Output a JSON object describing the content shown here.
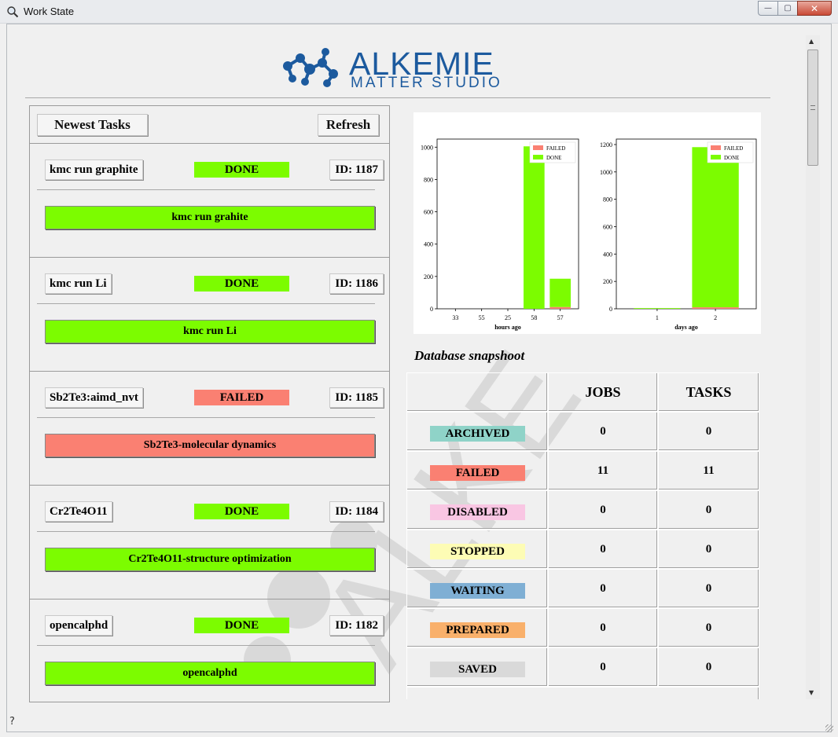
{
  "window": {
    "title": "Work State",
    "controls": {
      "minimize": "—",
      "maximize": "▢",
      "close": "✕"
    }
  },
  "logo": {
    "line1": "ALKEMIE",
    "line2": "MATTER STUDIO",
    "color": "#1c5a9e"
  },
  "task_panel": {
    "header_label": "Newest Tasks",
    "refresh_label": "Refresh",
    "tasks": [
      {
        "name": "kmc run graphite",
        "status": "DONE",
        "id": "ID: 1187",
        "description": "kmc run grahite"
      },
      {
        "name": "kmc run Li",
        "status": "DONE",
        "id": "ID: 1186",
        "description": "kmc run Li"
      },
      {
        "name": "Sb2Te3:aimd_nvt",
        "status": "FAILED",
        "id": "ID: 1185",
        "description": "Sb2Te3-molecular dynamics"
      },
      {
        "name": "Cr2Te4O11",
        "status": "DONE",
        "id": "ID: 1184",
        "description": "Cr2Te4O11-structure optimization"
      },
      {
        "name": "opencalphd",
        "status": "DONE",
        "id": "ID: 1182",
        "description": "opencalphd"
      }
    ]
  },
  "status_colors": {
    "DONE": "#7cfc00",
    "FAILED": "#fa8072",
    "ARCHIVED": "#8fd3c8",
    "DISABLED": "#f9c6e3",
    "STOPPED": "#fdfcb5",
    "WAITING": "#7fafd4",
    "PREPARED": "#f9b06b",
    "SAVED": "#d9d9d9"
  },
  "chart_data": [
    {
      "type": "bar",
      "stacked": true,
      "categories": [
        "33",
        "55",
        "25",
        "58",
        "57"
      ],
      "xlabel": "hours ago",
      "ylabel": "",
      "ylim": [
        0,
        1050
      ],
      "yticks": [
        0,
        200,
        400,
        600,
        800,
        1000
      ],
      "legend_position": "top-right",
      "series": [
        {
          "name": "FAILED",
          "color": "#fa8072",
          "values": [
            0,
            0,
            0,
            0,
            11
          ]
        },
        {
          "name": "DONE",
          "color": "#7cfc00",
          "values": [
            0,
            0,
            0,
            1005,
            175
          ]
        }
      ]
    },
    {
      "type": "bar",
      "stacked": true,
      "categories": [
        "1",
        "2"
      ],
      "xlabel": "days ago",
      "ylabel": "",
      "ylim": [
        0,
        1240
      ],
      "yticks": [
        0,
        200,
        400,
        600,
        800,
        1000,
        1200
      ],
      "legend_position": "top-right",
      "series": [
        {
          "name": "FAILED",
          "color": "#fa8072",
          "values": [
            0,
            11
          ]
        },
        {
          "name": "DONE",
          "color": "#7cfc00",
          "values": [
            5,
            1170
          ]
        }
      ]
    }
  ],
  "database": {
    "title": "Database snapshoot",
    "columns": [
      "",
      "JOBS",
      "TASKS"
    ],
    "rows": [
      {
        "state": "ARCHIVED",
        "jobs": "0",
        "tasks": "0"
      },
      {
        "state": "FAILED",
        "jobs": "11",
        "tasks": "11"
      },
      {
        "state": "DISABLED",
        "jobs": "0",
        "tasks": "0"
      },
      {
        "state": "STOPPED",
        "jobs": "0",
        "tasks": "0"
      },
      {
        "state": "WAITING",
        "jobs": "0",
        "tasks": "0"
      },
      {
        "state": "PREPARED",
        "jobs": "0",
        "tasks": "0"
      },
      {
        "state": "SAVED",
        "jobs": "0",
        "tasks": "0"
      }
    ]
  },
  "footer": {
    "help_icon": "?"
  }
}
